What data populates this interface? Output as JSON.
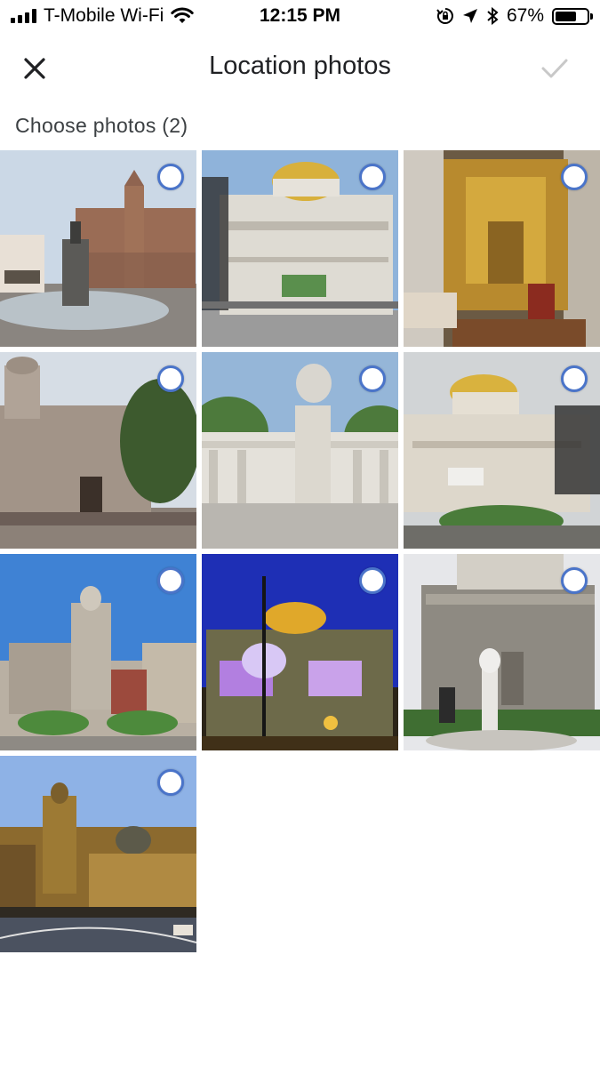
{
  "status_bar": {
    "carrier": "T-Mobile Wi-Fi",
    "time": "12:15 PM",
    "battery": "67%",
    "battery_level": 0.67,
    "icons": [
      "signal-bars-icon",
      "wifi-icon",
      "rotation-lock-icon",
      "location-arrow-icon",
      "bluetooth-icon",
      "battery-icon"
    ]
  },
  "app_bar": {
    "title": "Location photos",
    "close_icon": "close-icon",
    "confirm_icon": "checkmark-icon"
  },
  "section": {
    "label": "Choose photos (2)"
  },
  "colors": {
    "accent": "#4a74c9",
    "text": "#202124",
    "disabled": "#c8c8c8"
  },
  "photos": [
    {
      "id": "photo-1",
      "selected": false
    },
    {
      "id": "photo-2",
      "selected": false
    },
    {
      "id": "photo-3",
      "selected": false
    },
    {
      "id": "photo-4",
      "selected": false
    },
    {
      "id": "photo-5",
      "selected": false
    },
    {
      "id": "photo-6",
      "selected": false
    },
    {
      "id": "photo-7",
      "selected": false
    },
    {
      "id": "photo-8",
      "selected": false
    },
    {
      "id": "photo-9",
      "selected": false
    },
    {
      "id": "photo-10",
      "selected": false
    }
  ]
}
